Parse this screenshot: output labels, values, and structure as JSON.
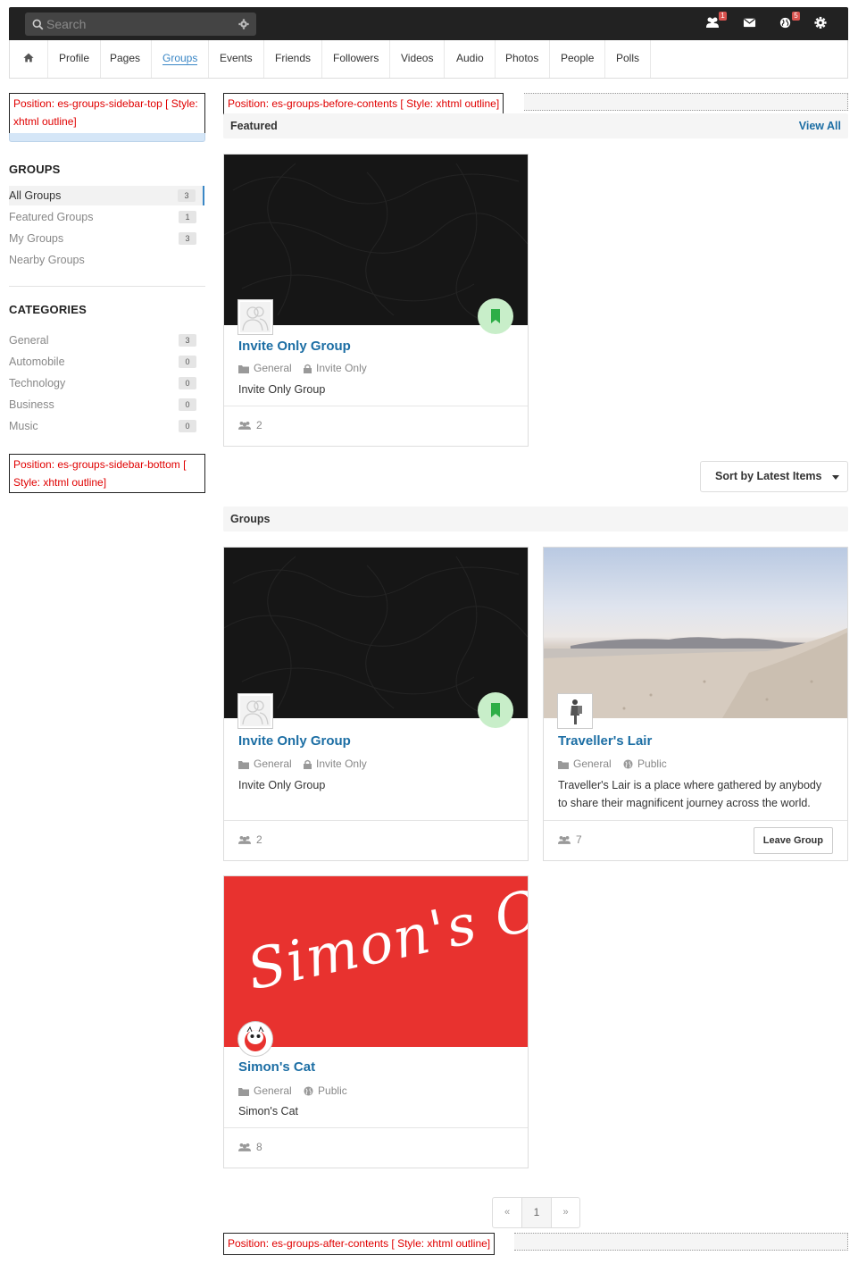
{
  "toolbar": {
    "search_placeholder": "Search",
    "friends_badge": "1",
    "notifications_badge": "5"
  },
  "nav": {
    "items": [
      "Profile",
      "Pages",
      "Groups",
      "Events",
      "Friends",
      "Followers",
      "Videos",
      "Audio",
      "Photos",
      "People",
      "Polls"
    ],
    "active": "Groups"
  },
  "positions": {
    "sidebar_top": "Position: es-groups-sidebar-top [ Style: xhtml outline]",
    "before_contents": "Position: es-groups-before-contents [ Style: xhtml outline]",
    "sidebar_bottom": "Position: es-groups-sidebar-bottom [ Style: xhtml outline]",
    "after_contents": "Position: es-groups-after-contents [ Style: xhtml outline]"
  },
  "sidebar": {
    "groups_heading": "GROUPS",
    "groups": [
      {
        "label": "All Groups",
        "count": "3"
      },
      {
        "label": "Featured Groups",
        "count": "1"
      },
      {
        "label": "My Groups",
        "count": "3"
      },
      {
        "label": "Nearby Groups",
        "count": ""
      }
    ],
    "categories_heading": "CATEGORIES",
    "categories": [
      {
        "label": "General",
        "count": "3"
      },
      {
        "label": "Automobile",
        "count": "0"
      },
      {
        "label": "Technology",
        "count": "0"
      },
      {
        "label": "Business",
        "count": "0"
      },
      {
        "label": "Music",
        "count": "0"
      }
    ]
  },
  "featured": {
    "heading": "Featured",
    "view_all": "View All",
    "card": {
      "title": "Invite Only Group",
      "category": "General",
      "privacy": "Invite Only",
      "description": "Invite Only Group",
      "members": "2"
    }
  },
  "sort": {
    "label": "Sort by Latest Items"
  },
  "groups": {
    "heading": "Groups",
    "cards": [
      {
        "title": "Invite Only Group",
        "category": "General",
        "privacy": "Invite Only",
        "description": "Invite Only Group",
        "members": "2"
      },
      {
        "title": "Traveller's Lair",
        "category": "General",
        "privacy": "Public",
        "description": "Traveller's Lair is a place where gathered by anybody to share their magnificent journey across the world.",
        "members": "7",
        "action": "Leave Group"
      },
      {
        "title": "Simon's Cat",
        "category": "General",
        "privacy": "Public",
        "description": "Simon's Cat",
        "members": "8",
        "cover_text": "Simon's Cat"
      }
    ]
  },
  "pagination": {
    "prev": "«",
    "current": "1",
    "next": "»"
  },
  "colors": {
    "link": "#1c6ea4",
    "accent": "#3a87c6",
    "badge": "#d9534f",
    "featured_badge": "#c8eec9",
    "simons_cat_red": "#e8322f"
  }
}
